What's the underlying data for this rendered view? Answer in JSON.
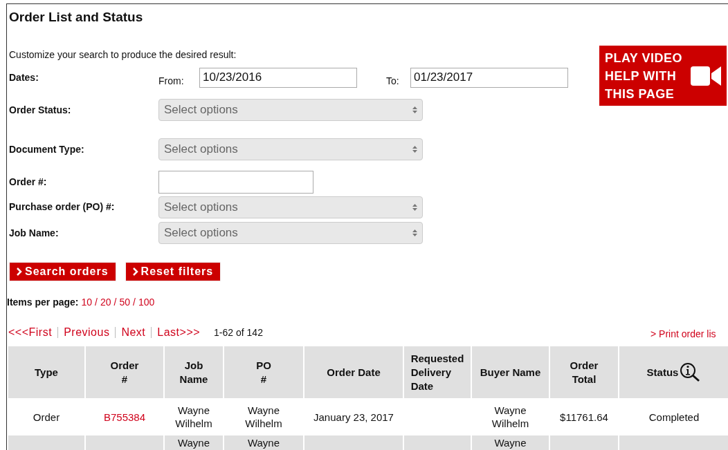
{
  "title": "Order List and Status",
  "intro": "Customize your search to produce the desired result:",
  "video_banner": {
    "lines": [
      "PLAY VIDEO",
      "HELP WITH",
      "THIS PAGE"
    ]
  },
  "filters": [
    {
      "kind": "dates",
      "label": "Dates:",
      "from_label": "From:",
      "from_value": "10/23/2016",
      "to_label": "To:",
      "to_value": "01/23/2017"
    },
    {
      "kind": "select",
      "label": "Order Status:",
      "placeholder": "Select options"
    },
    {
      "kind": "select",
      "label": "Document Type:",
      "placeholder": "Select options"
    },
    {
      "kind": "text",
      "label": "Order #:"
    },
    {
      "kind": "select",
      "label": "Purchase order (PO) #:",
      "placeholder": "Select options"
    },
    {
      "kind": "select",
      "label": "Job Name:",
      "placeholder": "Select options"
    }
  ],
  "buttons": [
    "Search orders",
    "Reset filters"
  ],
  "items_per_page": {
    "label": "Items per page:",
    "options": [
      "10",
      "20",
      "50",
      "100"
    ],
    "separator": "/"
  },
  "pager": {
    "links": [
      "<<<First",
      "Previous",
      "Next",
      "Last>>>"
    ],
    "range": "1-62 of 142"
  },
  "print_link": "> Print order lis",
  "table": {
    "columns": [
      [
        "Type"
      ],
      [
        "Order",
        "#"
      ],
      [
        "Job",
        "Name"
      ],
      [
        "PO",
        "#"
      ],
      [
        "Order Date"
      ],
      [
        "Requested",
        "Delivery",
        "Date"
      ],
      [
        "Buyer Name"
      ],
      [
        "Order",
        "Total"
      ],
      [
        "Status"
      ]
    ],
    "rows": [
      {
        "type": "Order",
        "order": "B755384",
        "job_name": [
          "Wayne",
          "Wilhelm"
        ],
        "po": [
          "Wayne",
          "Wilhelm"
        ],
        "order_date": "January 23, 2017",
        "buyer": [
          "Wayne",
          "Wilhelm"
        ],
        "total": "$11761.64",
        "status": "Completed"
      },
      {
        "job_name": [
          "Wayne"
        ],
        "po": [
          "Wayne"
        ],
        "buyer": [
          "Wayne"
        ]
      }
    ]
  }
}
